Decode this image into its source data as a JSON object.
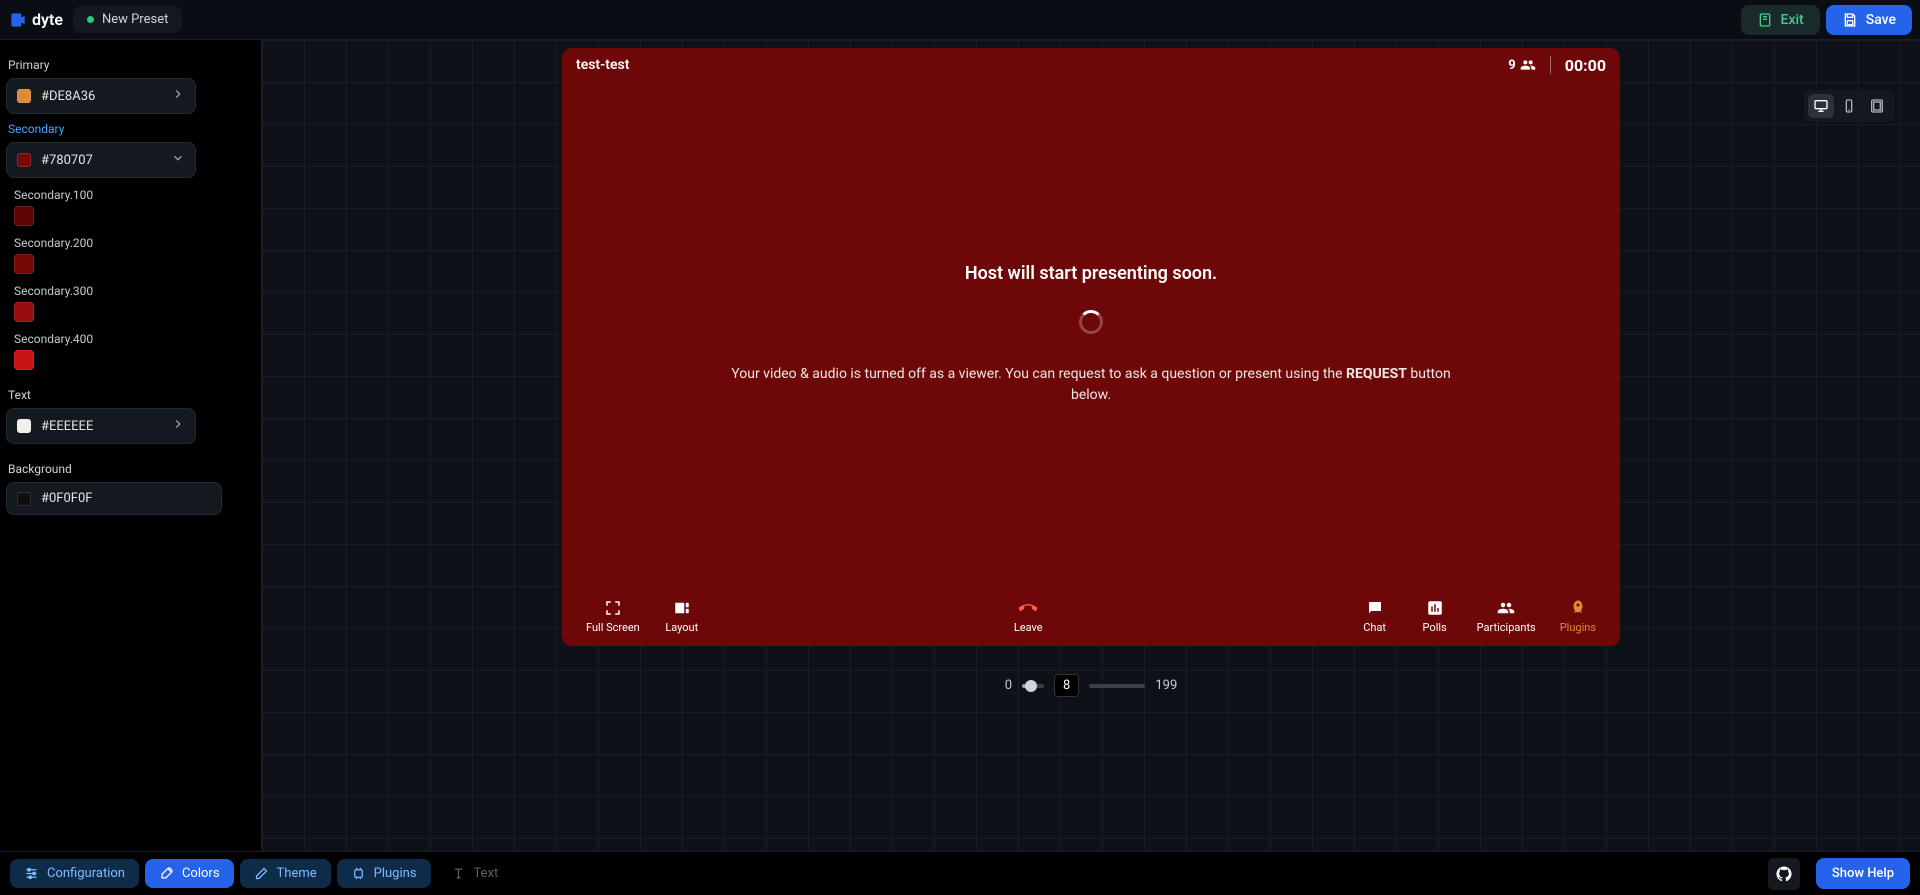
{
  "brand": "dyte",
  "preset_name": "New Preset",
  "topbar": {
    "exit": "Exit",
    "save": "Save"
  },
  "sidebar": {
    "primary": {
      "label": "Primary",
      "value": "#DE8A36",
      "swatch": "#de8a36"
    },
    "secondary": {
      "label": "Secondary",
      "value": "#780707",
      "swatch": "#780707",
      "shades": [
        {
          "label": "Secondary.100",
          "swatch": "#5e0606"
        },
        {
          "label": "Secondary.200",
          "swatch": "#780707"
        },
        {
          "label": "Secondary.300",
          "swatch": "#9b0c0c"
        },
        {
          "label": "Secondary.400",
          "swatch": "#c91212"
        }
      ]
    },
    "text": {
      "label": "Text",
      "value": "#EEEEEE",
      "swatch": "#eeeeee"
    },
    "background": {
      "label": "Background",
      "value": "#0F0F0F",
      "swatch": "#0f0f0f"
    }
  },
  "preview": {
    "title": "test-test",
    "participants": "9",
    "time": "00:00",
    "headline": "Host will start presenting soon.",
    "sub_a": "Your video & audio is turned off as a viewer. You can request to ask a question or present using the ",
    "sub_strong": "REQUEST",
    "sub_b": " button below.",
    "controls": {
      "fullscreen": "Full Screen",
      "layout": "Layout",
      "leave": "Leave",
      "chat": "Chat",
      "polls": "Polls",
      "participants": "Participants",
      "plugins": "Plugins"
    }
  },
  "slider": {
    "min": "0",
    "value": "8",
    "max": "199"
  },
  "tabs": {
    "configuration": "Configuration",
    "colors": "Colors",
    "theme": "Theme",
    "plugins": "Plugins",
    "text": "Text"
  },
  "help": "Show Help"
}
